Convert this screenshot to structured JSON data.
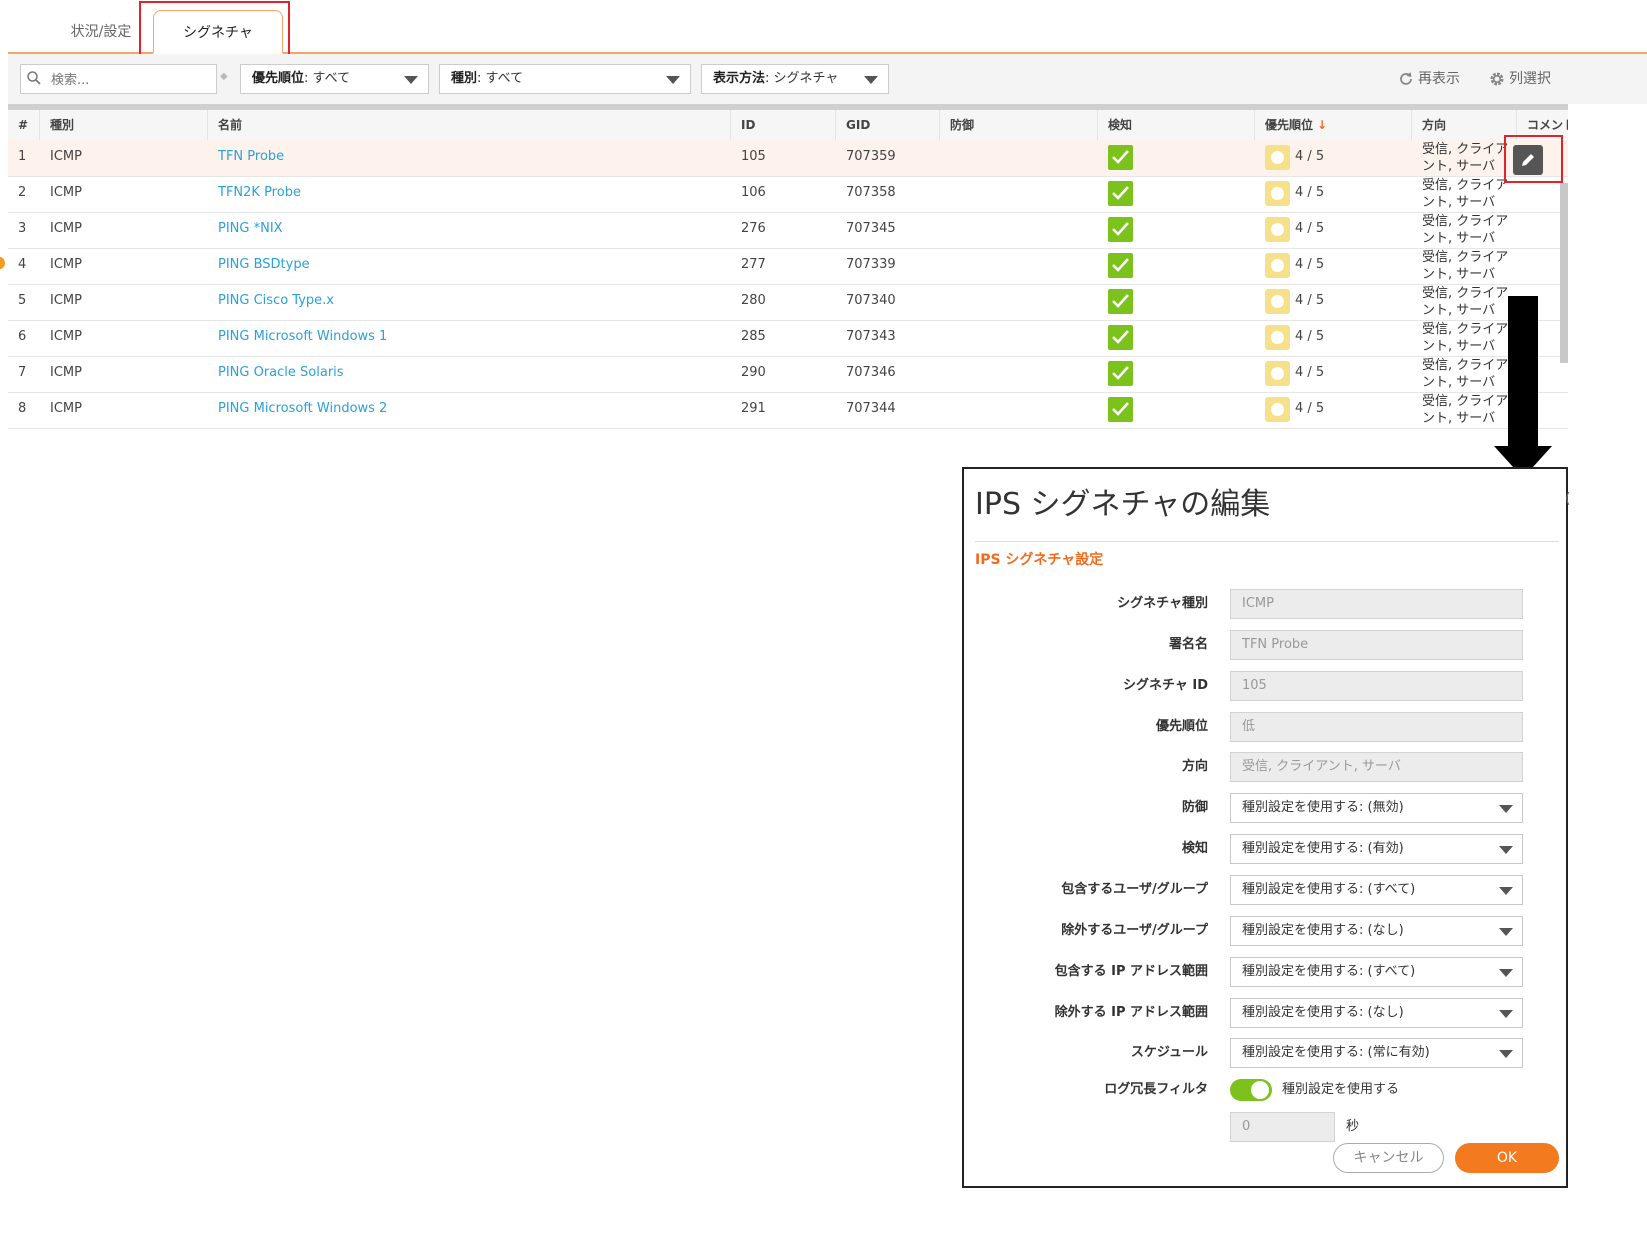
{
  "tabs": {
    "status_label": "状況/設定",
    "signature_label": "シグネチャ"
  },
  "toolbar": {
    "search_placeholder": "検索...",
    "priority_label": "優先順位",
    "priority_value": ": すべて",
    "type_label": "種別",
    "type_value": ": すべて",
    "view_label": "表示方法",
    "view_value": ": シグネチャ",
    "refresh_label": "再表示",
    "columns_label": "列選択"
  },
  "table": {
    "columns": [
      "#",
      "種別",
      "名前",
      "ID",
      "GID",
      "防御",
      "検知",
      "優先順位",
      "方向",
      "コメント"
    ],
    "rows": [
      {
        "num": "1",
        "type": "ICMP",
        "name": "TFN Probe",
        "id": "105",
        "gid": "707359",
        "detect": true,
        "priority": "4 / 5",
        "direction": "受信, クライアント, サーバ"
      },
      {
        "num": "2",
        "type": "ICMP",
        "name": "TFN2K Probe",
        "id": "106",
        "gid": "707358",
        "detect": true,
        "priority": "4 / 5",
        "direction": "受信, クライアント, サーバ"
      },
      {
        "num": "3",
        "type": "ICMP",
        "name": "PING *NIX",
        "id": "276",
        "gid": "707345",
        "detect": true,
        "priority": "4 / 5",
        "direction": "受信, クライアント, サーバ"
      },
      {
        "num": "4",
        "type": "ICMP",
        "name": "PING BSDtype",
        "id": "277",
        "gid": "707339",
        "detect": true,
        "priority": "4 / 5",
        "direction": "受信, クライアント, サーバ"
      },
      {
        "num": "5",
        "type": "ICMP",
        "name": "PING Cisco Type.x",
        "id": "280",
        "gid": "707340",
        "detect": true,
        "priority": "4 / 5",
        "direction": "受信, クライアント, サーバ"
      },
      {
        "num": "6",
        "type": "ICMP",
        "name": "PING Microsoft Windows 1",
        "id": "285",
        "gid": "707343",
        "detect": true,
        "priority": "4 / 5",
        "direction": "受信, クライアント, サーバ"
      },
      {
        "num": "7",
        "type": "ICMP",
        "name": "PING Oracle Solaris",
        "id": "290",
        "gid": "707346",
        "detect": true,
        "priority": "4 / 5",
        "direction": "受信, クライアント, サーバ"
      },
      {
        "num": "8",
        "type": "ICMP",
        "name": "PING Microsoft Windows 2",
        "id": "291",
        "gid": "707344",
        "detect": true,
        "priority": "4 / 5",
        "direction": "受信, クライアント, サーバ"
      }
    ]
  },
  "dialog": {
    "title": "IPS シグネチャの編集",
    "section": "IPS シグネチャ設定",
    "fields": [
      {
        "label": "シグネチャ種別",
        "value": "ICMP",
        "kind": "readonly"
      },
      {
        "label": "署名名",
        "value": "TFN Probe",
        "kind": "readonly"
      },
      {
        "label": "シグネチャ ID",
        "value": "105",
        "kind": "readonly"
      },
      {
        "label": "優先順位",
        "value": "低",
        "kind": "readonly"
      },
      {
        "label": "方向",
        "value": "受信, クライアント, サーバ",
        "kind": "readonly"
      },
      {
        "label": "防御",
        "value": "種別設定を使用する: (無効)",
        "kind": "select"
      },
      {
        "label": "検知",
        "value": "種別設定を使用する: (有効)",
        "kind": "select"
      },
      {
        "label": "包含するユーザ/グループ",
        "value": "種別設定を使用する: (すべて)",
        "kind": "select"
      },
      {
        "label": "除外するユーザ/グループ",
        "value": "種別設定を使用する: (なし)",
        "kind": "select"
      },
      {
        "label": "包含する IP アドレス範囲",
        "value": "種別設定を使用する: (すべて)",
        "kind": "select"
      },
      {
        "label": "除外する IP アドレス範囲",
        "value": "種別設定を使用する: (なし)",
        "kind": "select"
      },
      {
        "label": "スケジュール",
        "value": "種別設定を使用する: (常に有効)",
        "kind": "select"
      }
    ],
    "log_filter": {
      "label": "ログ冗長フィルタ",
      "toggle_on": true,
      "toggle_text": "種別設定を使用する",
      "seconds_value": "0",
      "seconds_unit": "秒"
    },
    "cancel_label": "キャンセル",
    "ok_label": "OK"
  },
  "colors": {
    "accent_orange": "#f26b1d",
    "link_blue": "#2aa1d8",
    "check_green": "#7cc21c",
    "priority_yellow": "#f7e08a",
    "highlight_red": "#e0242a"
  }
}
